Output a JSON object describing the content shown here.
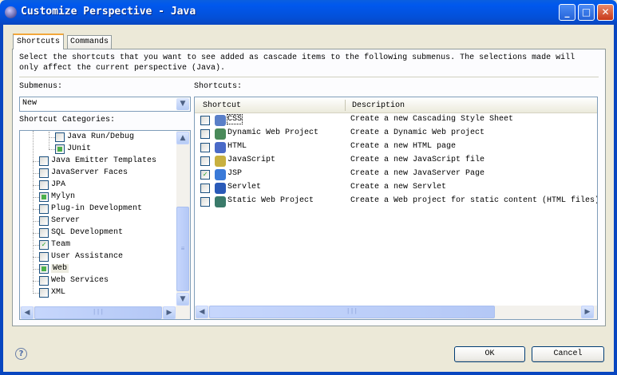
{
  "window": {
    "title": "Customize Perspective - Java",
    "minimize": "_",
    "maximize": "□",
    "close": "✕"
  },
  "tabs": [
    {
      "label": "Shortcuts",
      "active": true
    },
    {
      "label": "Commands",
      "active": false
    }
  ],
  "description": [
    "Select the shortcuts that you want to see added as cascade items to the following submenus.  The selections made will",
    "only affect the current perspective (Java)."
  ],
  "submenus": {
    "label": "Submenus:",
    "value": "New"
  },
  "categories": {
    "label": "Shortcut Categories:",
    "items": [
      {
        "label": "Java Run/Debug",
        "level": 2,
        "state": "unchecked"
      },
      {
        "label": "JUnit",
        "level": 2,
        "state": "partial"
      },
      {
        "label": "Java Emitter Templates",
        "level": 1,
        "state": "unchecked"
      },
      {
        "label": "JavaServer Faces",
        "level": 1,
        "state": "unchecked"
      },
      {
        "label": "JPA",
        "level": 1,
        "state": "unchecked"
      },
      {
        "label": "Mylyn",
        "level": 1,
        "state": "partial"
      },
      {
        "label": "Plug-in Development",
        "level": 1,
        "state": "unchecked"
      },
      {
        "label": "Server",
        "level": 1,
        "state": "unchecked"
      },
      {
        "label": "SQL Development",
        "level": 1,
        "state": "unchecked"
      },
      {
        "label": "Team",
        "level": 1,
        "state": "checked"
      },
      {
        "label": "User Assistance",
        "level": 1,
        "state": "unchecked"
      },
      {
        "label": "Web",
        "level": 1,
        "state": "partial",
        "selected": true
      },
      {
        "label": "Web Services",
        "level": 1,
        "state": "unchecked"
      },
      {
        "label": "XML",
        "level": 1,
        "state": "unchecked"
      }
    ]
  },
  "shortcuts": {
    "label": "Shortcuts:",
    "columns": [
      "Shortcut",
      "Description"
    ],
    "rows": [
      {
        "name": "CSS",
        "description": "Create a new Cascading Style Sheet",
        "checked": false,
        "icon": "css-file-icon",
        "color": "#5a7fc8"
      },
      {
        "name": "Dynamic Web Project",
        "description": "Create a Dynamic Web project",
        "checked": false,
        "icon": "web-project-icon",
        "color": "#4a8a5a"
      },
      {
        "name": "HTML",
        "description": "Create a new HTML page",
        "checked": false,
        "icon": "html-file-icon",
        "color": "#4a6ac8"
      },
      {
        "name": "JavaScript",
        "description": "Create a new JavaScript file",
        "checked": false,
        "icon": "javascript-file-icon",
        "color": "#c8b040"
      },
      {
        "name": "JSP",
        "description": "Create a new JavaServer Page",
        "checked": true,
        "icon": "jsp-file-icon",
        "color": "#3a7ad8"
      },
      {
        "name": "Servlet",
        "description": "Create a new Servlet",
        "checked": false,
        "icon": "servlet-icon",
        "color": "#2a5ab8"
      },
      {
        "name": "Static Web Project",
        "description": "Create a Web project for static content (HTML files)",
        "checked": false,
        "icon": "static-web-project-icon",
        "color": "#3a7a6a"
      }
    ]
  },
  "buttons": {
    "ok": "OK",
    "cancel": "Cancel",
    "help": "?"
  }
}
